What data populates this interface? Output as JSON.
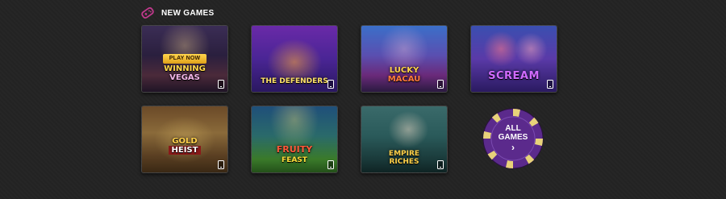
{
  "section": {
    "title": "NEW GAMES",
    "icon": "gamepad-icon",
    "accent_color": "#c0398c"
  },
  "games": [
    {
      "id": "winning-vegas",
      "title_lines": [
        "WINNING",
        "VEGAS"
      ],
      "hover_label": "PLAY NOW"
    },
    {
      "id": "the-defenders",
      "title_lines": [
        "THE DEFENDERS"
      ]
    },
    {
      "id": "lucky-macau",
      "title_lines": [
        "LUCKY",
        "MACAU"
      ]
    },
    {
      "id": "scream",
      "title_lines": [
        "SCREAM"
      ]
    },
    {
      "id": "gold-heist",
      "title_lines": [
        "GOLD",
        "HEIST"
      ]
    },
    {
      "id": "fruity-feast",
      "title_lines": [
        "FRUITY",
        "FEAST"
      ]
    },
    {
      "id": "empire-riches",
      "title_lines": [
        "EMPIRE",
        "RICHES"
      ]
    }
  ],
  "all_games": {
    "label_line1": "ALL",
    "label_line2": "GAMES",
    "chevron": "›",
    "chip_color": "#5b2a8c",
    "stripe_color": "#e8d27a"
  }
}
